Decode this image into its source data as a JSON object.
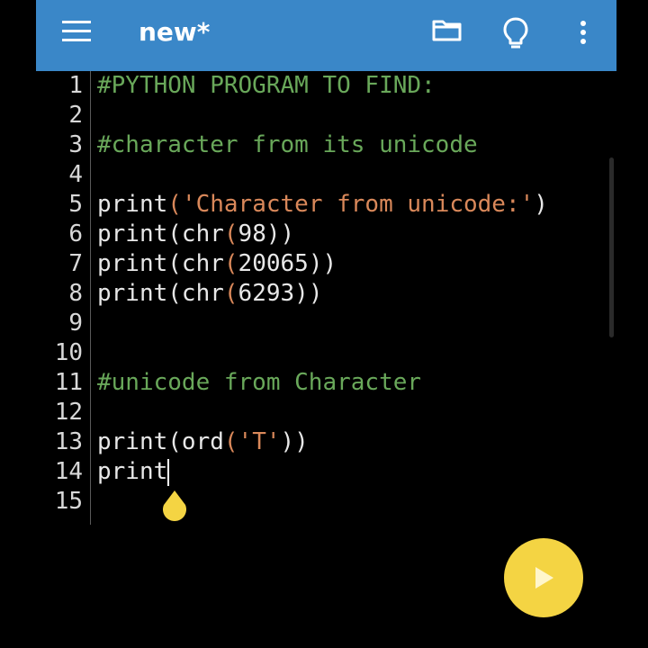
{
  "appbar": {
    "title": "new*",
    "background": "#3a87c8",
    "icons": [
      "menu-icon",
      "folder-icon",
      "lightbulb-icon",
      "more-vert-icon"
    ]
  },
  "editor": {
    "lines": [
      {
        "num": "1",
        "text": "#PYTHON PROGRAM TO FIND:"
      },
      {
        "num": "2",
        "text": ""
      },
      {
        "num": "3",
        "text": "#character from its unicode"
      },
      {
        "num": "4",
        "text": ""
      },
      {
        "num": "5",
        "fn": "print",
        "open": "(",
        "str": "'Character from unicode:'",
        "close": ")"
      },
      {
        "num": "6",
        "fn": "print(chr",
        "open": "(",
        "arg": "98",
        "close": "))"
      },
      {
        "num": "7",
        "fn": "print(chr",
        "open": "(",
        "arg": "20065",
        "close": "))"
      },
      {
        "num": "8",
        "fn": "print(chr",
        "open": "(",
        "arg": "6293",
        "close": "))"
      },
      {
        "num": "9",
        "text": ""
      },
      {
        "num": "10",
        "text": ""
      },
      {
        "num": "11",
        "text": "#unicode from Character"
      },
      {
        "num": "12",
        "text": ""
      },
      {
        "num": "13",
        "fn": "print(ord",
        "open": "(",
        "str": "'T'",
        "close": "))"
      },
      {
        "num": "14",
        "fn": "print"
      },
      {
        "num": "15",
        "text": ""
      }
    ],
    "comment_color": "#69a85a",
    "string_color": "#d9885a"
  },
  "run_button": {
    "icon": "play-icon",
    "color": "#f4d443"
  }
}
